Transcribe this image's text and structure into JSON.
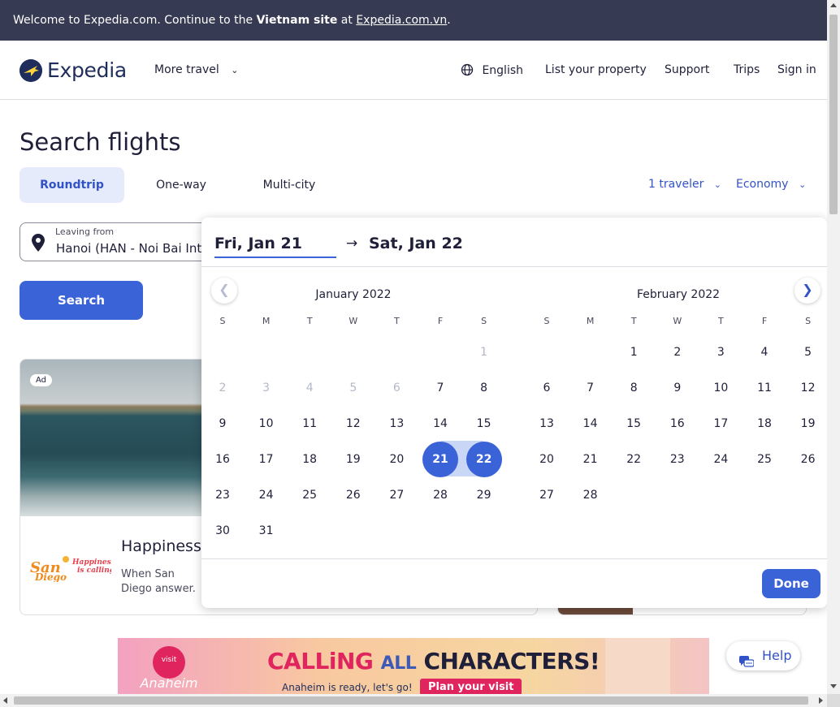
{
  "banner": {
    "prefix": "Welcome to Expedia.com. Continue to the ",
    "site_bold": "Vietnam site",
    "at": " at ",
    "link": "Expedia.com.vn",
    "suffix": "."
  },
  "nav": {
    "logo": "Expedia",
    "more_travel": "More travel",
    "language": "English",
    "list_property": "List your property",
    "support": "Support",
    "trips": "Trips",
    "sign_in": "Sign in"
  },
  "search": {
    "heading": "Search flights",
    "tabs": [
      "Roundtrip",
      "One-way",
      "Multi-city"
    ],
    "active_tab": "Roundtrip",
    "travelers": "1 traveler",
    "cabin": "Economy",
    "leaving_label": "Leaving from",
    "leaving_value": "Hanoi (HAN - Noi Bai Intl.)",
    "search_button": "Search"
  },
  "picker": {
    "start_date": "Fri, Jan 21",
    "end_date": "Sat, Jan 22",
    "weekdays": [
      "S",
      "M",
      "T",
      "W",
      "T",
      "F",
      "S"
    ],
    "months": [
      {
        "title": "January 2022",
        "weeks": [
          [
            "",
            "",
            "",
            "",
            "",
            "",
            "1"
          ],
          [
            "2",
            "3",
            "4",
            "5",
            "6",
            "7",
            "8"
          ],
          [
            "9",
            "10",
            "11",
            "12",
            "13",
            "14",
            "15"
          ],
          [
            "16",
            "17",
            "18",
            "19",
            "20",
            "21",
            "22"
          ],
          [
            "23",
            "24",
            "25",
            "26",
            "27",
            "28",
            "29"
          ],
          [
            "30",
            "31",
            "",
            "",
            "",
            "",
            ""
          ]
        ]
      },
      {
        "title": "February 2022",
        "weeks": [
          [
            "",
            "",
            "1",
            "2",
            "3",
            "4",
            "5"
          ],
          [
            "6",
            "7",
            "8",
            "9",
            "10",
            "11",
            "12"
          ],
          [
            "13",
            "14",
            "15",
            "16",
            "17",
            "18",
            "19"
          ],
          [
            "20",
            "21",
            "22",
            "23",
            "24",
            "25",
            "26"
          ],
          [
            "27",
            "28",
            "",
            "",
            "",
            "",
            ""
          ]
        ]
      }
    ],
    "done": "Done"
  },
  "ad": {
    "badge": "Ad",
    "title": "Happiness",
    "desc": "When San Diego answer.",
    "logo_text": "San Diego",
    "tagline": "Happiness is calling"
  },
  "promo": {
    "visit": "visit",
    "anaheim": "Anaheim",
    "calling": "CALLiNG",
    "all": "ALL",
    "characters": "CHARACTERS!",
    "ready": "Anaheim is ready, let's go!",
    "plan": "Plan your visit"
  },
  "help": {
    "label": "Help"
  },
  "colors": {
    "primary": "#3b63d8",
    "topbar": "#363a52",
    "selected_range": "#c9d6f6"
  }
}
